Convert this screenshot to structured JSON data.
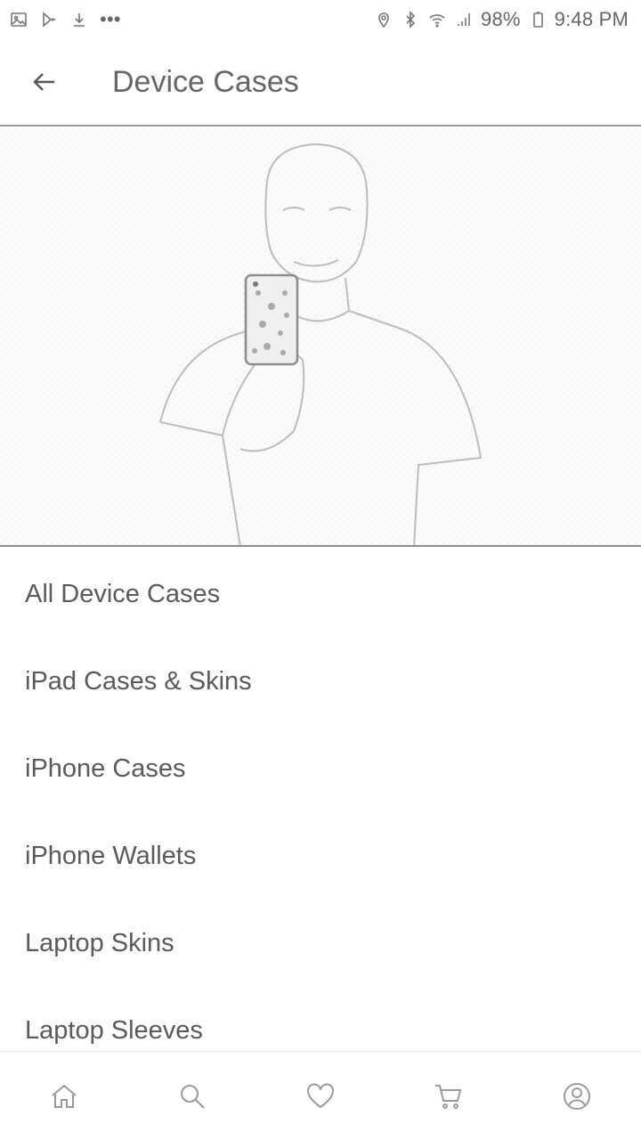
{
  "status_bar": {
    "battery": "98%",
    "time": "9:48 PM",
    "overflow": "•••"
  },
  "header": {
    "title": "Device Cases"
  },
  "hero": {
    "icon": "person-with-phone-case-photo"
  },
  "categories": [
    {
      "label": "All Device Cases"
    },
    {
      "label": "iPad Cases & Skins"
    },
    {
      "label": "iPhone Cases"
    },
    {
      "label": "iPhone Wallets"
    },
    {
      "label": "Laptop Skins"
    },
    {
      "label": "Laptop Sleeves"
    }
  ],
  "bottom_nav": {
    "items": [
      "home-icon",
      "search-icon",
      "heart-icon",
      "cart-icon",
      "profile-icon"
    ]
  }
}
